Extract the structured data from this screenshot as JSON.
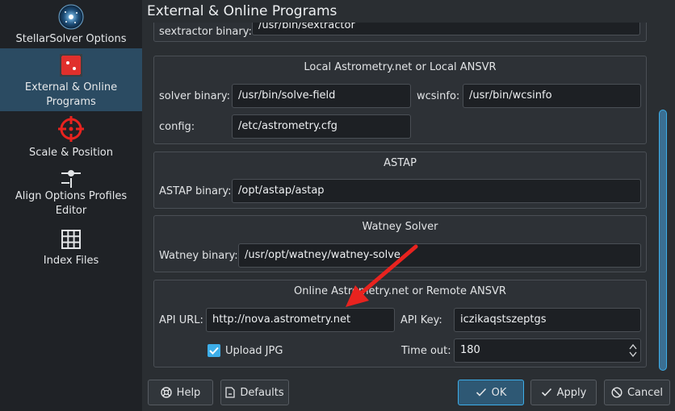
{
  "sidebar": {
    "items": [
      {
        "label": "StellarSolver Options",
        "icon": "stellarsolver-icon"
      },
      {
        "label": "External & Online",
        "label2": "Programs",
        "icon": "external-programs-icon",
        "active": true
      },
      {
        "label": "Scale & Position",
        "icon": "crosshair-icon"
      },
      {
        "label": "Align Options Profiles",
        "label2": "Editor",
        "icon": "slider-icon"
      },
      {
        "label": "Index Files",
        "icon": "grid-icon"
      }
    ]
  },
  "page_title": "External & Online Programs",
  "sextractor": {
    "label": "sextractor binary:",
    "value": "/usr/bin/sextractor"
  },
  "local_astrometry": {
    "title": "Local Astrometry.net or Local ANSVR",
    "solver_label": "solver binary:",
    "solver_value": "/usr/bin/solve-field",
    "wcsinfo_label": "wcsinfo:",
    "wcsinfo_value": "/usr/bin/wcsinfo",
    "config_label": "config:",
    "config_value": "/etc/astrometry.cfg"
  },
  "astap": {
    "title": "ASTAP",
    "label": "ASTAP binary:",
    "value": "/opt/astap/astap"
  },
  "watney": {
    "title": "Watney Solver",
    "label": "Watney binary:",
    "value": "/usr/opt/watney/watney-solve"
  },
  "online": {
    "title": "Online Astrometry.net or Remote ANSVR",
    "api_url_label": "API URL:",
    "api_url_value": "http://nova.astrometry.net",
    "api_key_label": "API Key:",
    "api_key_value": "iczikaqstszeptgs",
    "upload_jpg_label": "Upload JPG",
    "upload_jpg_checked": true,
    "timeout_label": "Time out:",
    "timeout_value": "180"
  },
  "buttons": {
    "help": "Help",
    "defaults": "Defaults",
    "ok": "OK",
    "apply": "Apply",
    "cancel": "Cancel"
  },
  "colors": {
    "accent": "#3daee9",
    "annotation_arrow": "#e8231f",
    "sidebar_active": "#2b4b62"
  }
}
